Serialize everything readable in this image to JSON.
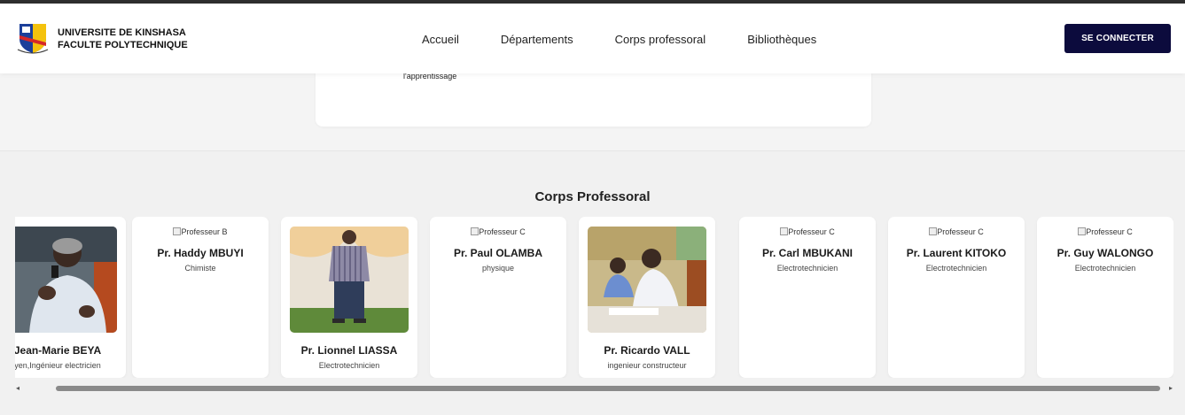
{
  "header": {
    "brand_line1": "UNIVERSITE DE KINSHASA",
    "brand_line2": "FACULTE POLYTECHNIQUE",
    "logo_icon": "university-crest-icon",
    "nav": [
      {
        "label": "Accueil"
      },
      {
        "label": "Départements"
      },
      {
        "label": "Corps professoral"
      },
      {
        "label": "Bibliothèques"
      }
    ],
    "login_label": "SE CONNECTER"
  },
  "panel": {
    "text": "l'apprentissage"
  },
  "faculty": {
    "title": "Corps Professoral",
    "cards": [
      {
        "name": "Jean-Marie BEYA",
        "role": "yen,Ingénieur electricien",
        "alt": "",
        "photo": "speaker-photo"
      },
      {
        "name": "Pr. Haddy MBUYI",
        "role": "Chimiste",
        "alt": "Professeur B",
        "photo": ""
      },
      {
        "name": "Pr. Lionnel LIASSA",
        "role": "Electrotechnicien",
        "alt": "",
        "photo": "standing-photo"
      },
      {
        "name": "Pr. Paul OLAMBA",
        "role": "physique",
        "alt": "Professeur C",
        "photo": ""
      },
      {
        "name": "Pr. Ricardo VALL",
        "role": "ingenieur constructeur",
        "alt": "",
        "photo": "classroom-photo"
      },
      {
        "name": "Pr. Carl MBUKANI",
        "role": "Electrotechnicien",
        "alt": "Professeur C",
        "photo": ""
      },
      {
        "name": "Pr. Laurent KITOKO",
        "role": "Electrotechnicien",
        "alt": "Professeur C",
        "photo": ""
      },
      {
        "name": "Pr. Guy WALONGO",
        "role": "Electrotechnicien",
        "alt": "Professeur C",
        "photo": ""
      }
    ]
  },
  "scrollbar": {
    "left_arrow": "◂",
    "right_arrow": "▸"
  },
  "colors": {
    "accent": "#0c0b3d",
    "page_bg": "#f4f4f4"
  }
}
